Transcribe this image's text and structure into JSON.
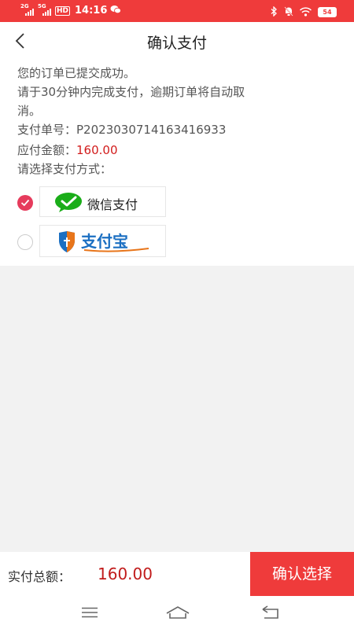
{
  "status_bar": {
    "net_2g": "2G",
    "net_5g": "5G",
    "hd": "HD",
    "time": "14:16",
    "battery": "54"
  },
  "header": {
    "title": "确认支付"
  },
  "order": {
    "line1": "您的订单已提交成功。",
    "line2": "请于30分钟内完成支付，逾期订单将自动取",
    "line3": "消。",
    "order_no_label": "支付单号：",
    "order_no": "P20230307141634169​33",
    "amount_label": "应付金额：",
    "amount": "160.00",
    "method_prompt": "请选择支付方式："
  },
  "payment_methods": [
    {
      "label": "微信支付",
      "selected": true,
      "icon": "wechat-icon"
    },
    {
      "label": "支付宝",
      "selected": false,
      "icon": "alipay-logo"
    }
  ],
  "footer": {
    "total_label": "实付总额：",
    "total_value": "160.00",
    "confirm_label": "确认选择"
  },
  "colors": {
    "accent": "#ef3b3b",
    "price": "#d21c1c",
    "radio_checked": "#e63b5c",
    "wechat_green": "#1aad19",
    "alipay_blue": "#1b6fc2",
    "alipay_orange": "#e8751a"
  }
}
